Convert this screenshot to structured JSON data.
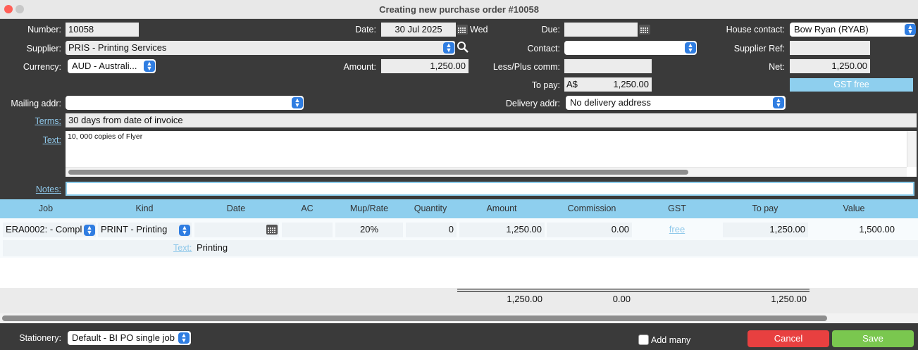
{
  "window": {
    "title": "Creating new purchase order #10058"
  },
  "colors": {
    "accent_blue": "#2f7de1",
    "header_bg": "#8ecfee",
    "cancel": "#e84040",
    "save": "#7ac74f",
    "gst_free": "#8ecfee"
  },
  "form": {
    "number_label": "Number:",
    "number": "10058",
    "date_label": "Date:",
    "date": "30 Jul 2025",
    "weekday": "Wed",
    "due_label": "Due:",
    "due": "",
    "house_contact_label": "House contact:",
    "house_contact": "Bow Ryan (RYAB)",
    "supplier_label": "Supplier:",
    "supplier": "PRIS - Printing Services",
    "contact_label": "Contact:",
    "contact": "",
    "supplier_ref_label": "Supplier Ref:",
    "supplier_ref": "",
    "currency_label": "Currency:",
    "currency": "AUD - Australi...",
    "amount_label": "Amount:",
    "amount": "1,250.00",
    "less_plus_label": "Less/Plus comm:",
    "less_plus": "",
    "net_label": "Net:",
    "net": "1,250.00",
    "to_pay_label": "To pay:",
    "to_pay_currency": "A$",
    "to_pay": "1,250.00",
    "gst_free_label": "GST free",
    "mailing_label": "Mailing addr:",
    "mailing": "",
    "delivery_label": "Delivery addr:",
    "delivery": "No delivery address",
    "terms_label": "Terms:",
    "terms": "30 days from date of invoice",
    "text_label": "Text:",
    "text": "10, 000 copies of Flyer",
    "notes_label": "Notes:",
    "notes": ""
  },
  "table": {
    "headers": [
      "Job",
      "Kind",
      "Date",
      "AC",
      "Mup/Rate",
      "Quantity",
      "Amount",
      "Commission",
      "GST",
      "To pay",
      "Value"
    ],
    "row": {
      "job": "ERA0002: - Compl",
      "kind": "PRINT -  Printing",
      "date": "",
      "ac": "",
      "mup_rate": "20%",
      "quantity": "0",
      "amount": "1,250.00",
      "commission": "0.00",
      "gst": "free",
      "to_pay": "1,250.00",
      "value": "1,500.00",
      "text_label": "Text:",
      "text": "Printing"
    },
    "totals": {
      "amount": "1,250.00",
      "commission": "0.00",
      "to_pay": "1,250.00"
    }
  },
  "footer": {
    "stationery_label": "Stationery:",
    "stationery": "Default - BI PO single job",
    "add_many_label": "Add many",
    "cancel_label": "Cancel",
    "save_label": "Save"
  }
}
